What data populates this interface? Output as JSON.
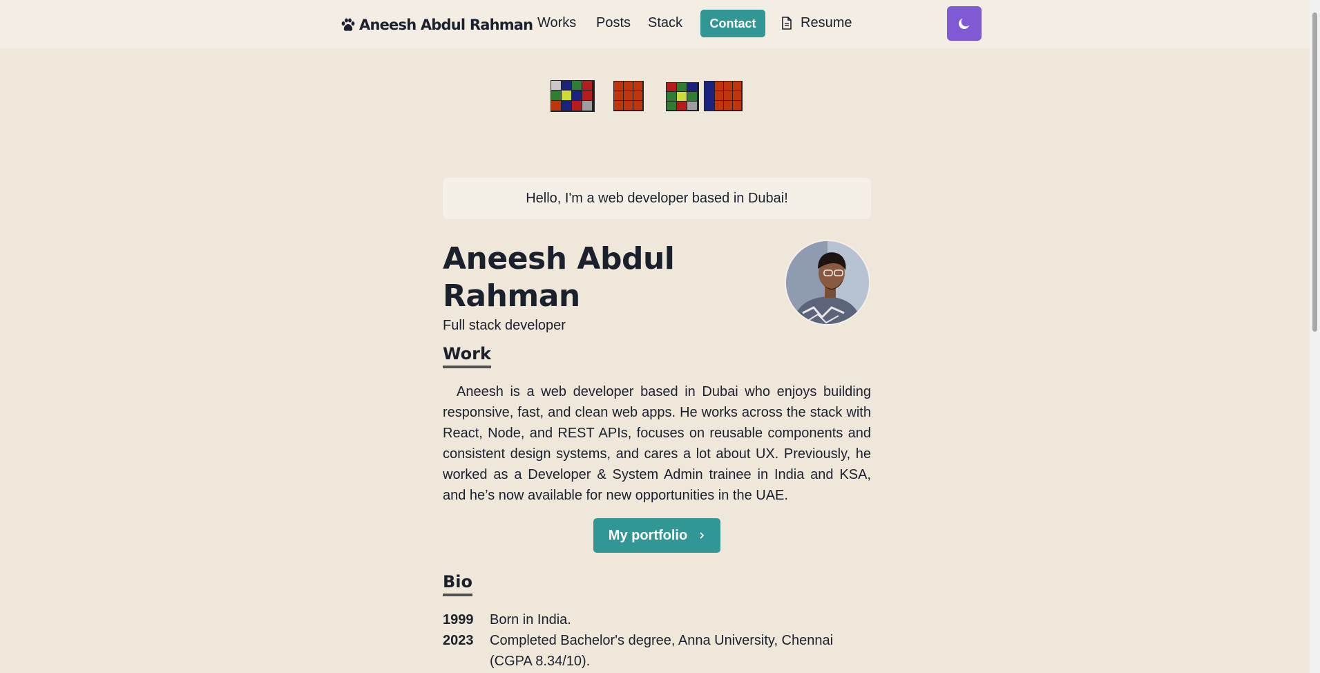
{
  "nav": {
    "logo_text": "Aneesh Abdul Rahman",
    "links": [
      "Works",
      "Posts",
      "Stack"
    ],
    "contact": "Contact",
    "resume": "Resume"
  },
  "hero": {
    "greeting": "Hello, I'm a web developer based in Dubai!",
    "name": "Aneesh Abdul Rahman",
    "subtitle": "Full stack developer"
  },
  "work": {
    "heading": "Work",
    "paragraph": "Aneesh is a web developer based in Dubai who enjoys building responsive, fast, and clean web apps. He works across the stack with React, Node, and REST APIs, focuses on reusable components and consistent design systems, and cares a lot about UX. Previously, he worked as a Developer & System Admin trainee in India and KSA, and he’s now available for new opportunities in the UAE.",
    "button": "My portfolio"
  },
  "bio": {
    "heading": "Bio",
    "entries": [
      {
        "year": "1999",
        "text": "Born in India."
      },
      {
        "year": "2023",
        "text": "Completed Bachelor's degree, Anna University, Chennai (CGPA 8.34/10)."
      }
    ]
  },
  "colors": {
    "background": "#f0e7db",
    "accent_teal": "#319795",
    "accent_purple": "#805ad5"
  },
  "icons": {
    "logo": "paw-icon",
    "resume": "document-icon",
    "theme": "moon-icon",
    "portfolio": "chevron-right-icon"
  }
}
